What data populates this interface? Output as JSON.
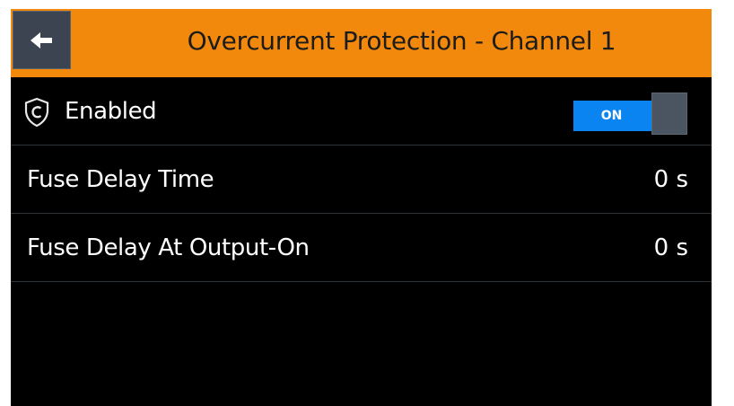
{
  "header": {
    "title": "Overcurrent Protection - Channel 1",
    "back_icon": "arrow-left-icon"
  },
  "rows": [
    {
      "label": "Enabled",
      "icon": "shield-icon",
      "toggle": {
        "state": "ON",
        "on": true
      }
    },
    {
      "label": "Fuse Delay Time",
      "value": "0 s"
    },
    {
      "label": "Fuse Delay At Output-On",
      "value": "0 s"
    }
  ],
  "colors": {
    "header_bg": "#f2890c",
    "screen_bg": "#000000",
    "toggle_on": "#0a84f0",
    "divider": "#2b333b",
    "back_button_bg": "#3b4450"
  }
}
